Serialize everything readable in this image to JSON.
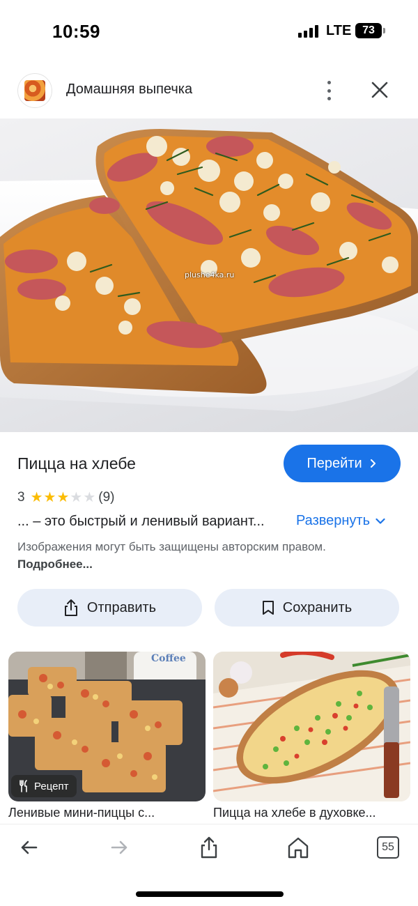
{
  "status_bar": {
    "time": "10:59",
    "network": "LTE",
    "battery": "73"
  },
  "header": {
    "site_name": "Домашняя выпечка",
    "favicon": "site-logo-icon",
    "more_icon": "more-vert-icon",
    "close_icon": "close-icon"
  },
  "hero": {
    "watermark": "plushe4ka.ru"
  },
  "result": {
    "title": "Пицца на хлебе",
    "go_button_label": "Перейти",
    "rating_value": "3",
    "rating": 3,
    "rating_max": 5,
    "rating_count": "(9)",
    "snippet": "... – это быстрый и ленивый вариант...",
    "expand_label": "Развернуть",
    "copyright_text": "Изображения могут быть защищены авторским правом.",
    "copyright_link": "Подробнее..."
  },
  "actions": {
    "share_label": "Отправить",
    "save_label": "Сохранить"
  },
  "related": [
    {
      "caption": "Ленивые мини-пиццы с...",
      "badge": "Рецепт",
      "cup_text": "Coffee"
    },
    {
      "caption": "Пицца на хлебе в духовке..."
    }
  ],
  "bottom_nav": {
    "back_icon": "arrow-back-icon",
    "forward_icon": "arrow-forward-icon",
    "share_icon": "share-icon",
    "home_icon": "home-icon",
    "tabs_count": "55"
  },
  "colors": {
    "accent": "#1a73e8",
    "star_filled": "#fbbc04",
    "star_empty": "#dadce0",
    "chip_bg": "#e8eef8"
  }
}
